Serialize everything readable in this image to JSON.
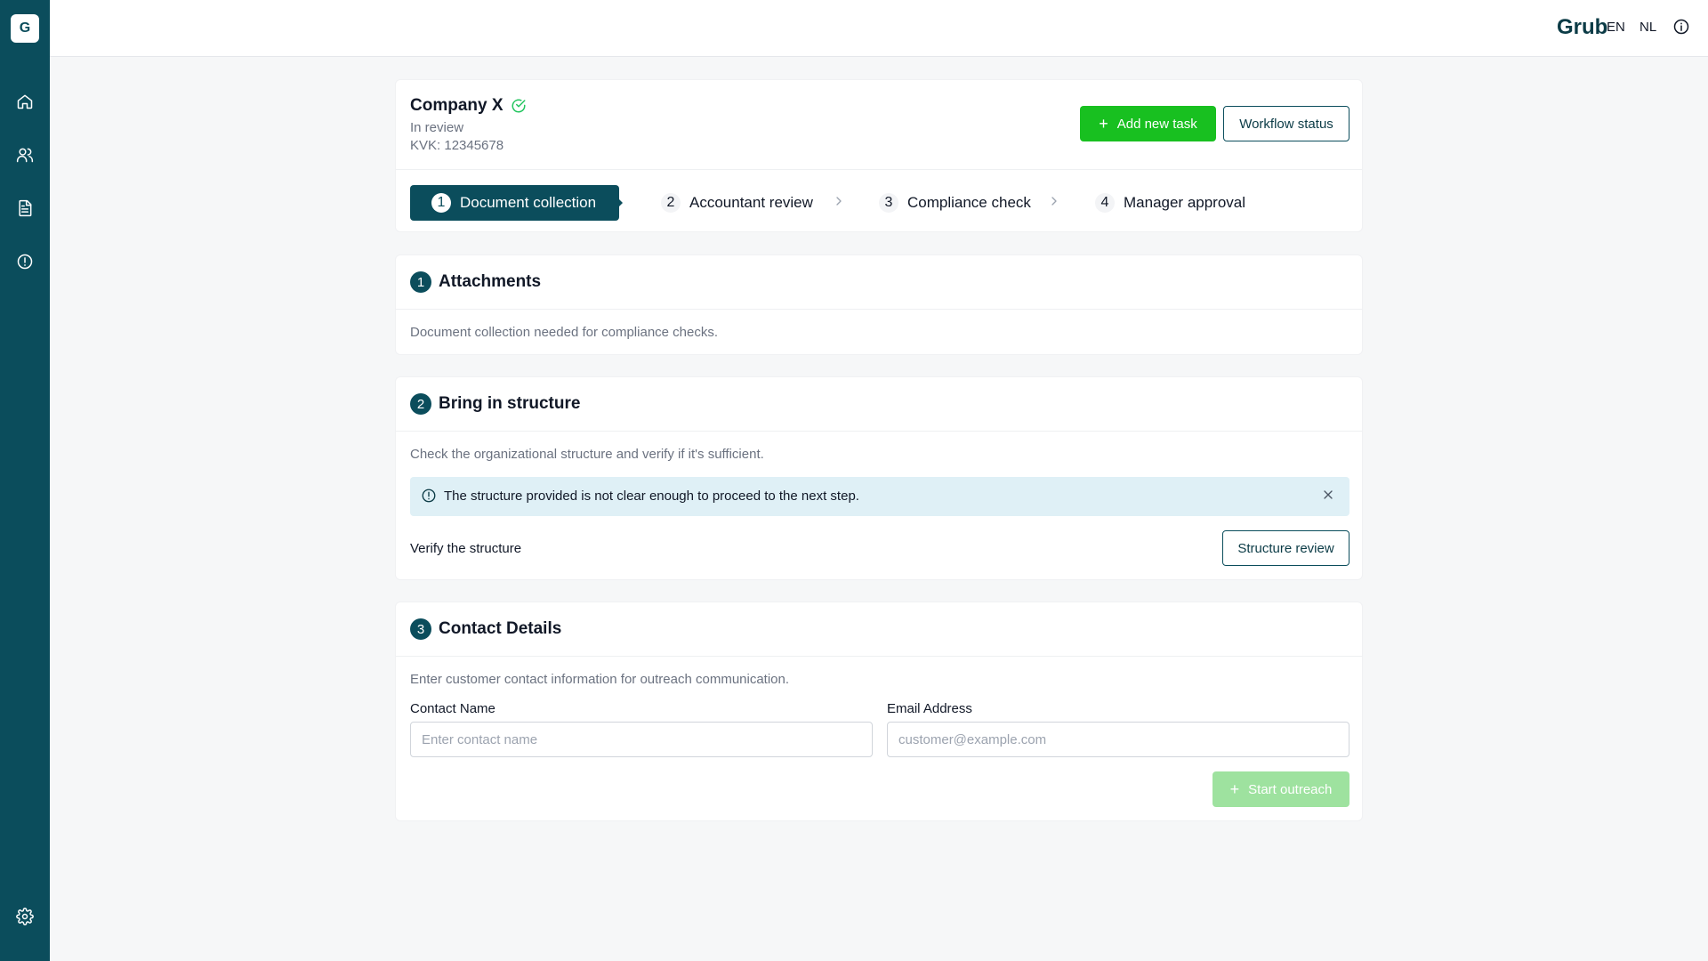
{
  "sidebar": {
    "logo_letter": "G",
    "items": [
      {
        "icon": "home-icon"
      },
      {
        "icon": "users-icon"
      },
      {
        "icon": "document-icon"
      },
      {
        "icon": "alert-circle-icon"
      },
      {
        "icon": "gear-icon"
      }
    ]
  },
  "header": {
    "brand": "Grub",
    "languages": [
      "EN",
      "NL"
    ],
    "info_icon": "info-icon"
  },
  "company": {
    "name": "Company X",
    "verified_icon": "check-circle-icon",
    "status": "In review",
    "kvk": "KVK: 12345678",
    "add_task_label": "Add new task",
    "workflow_status_label": "Workflow status"
  },
  "stepper": {
    "steps": [
      {
        "number": "1",
        "label": "Document collection",
        "active": true
      },
      {
        "number": "2",
        "label": "Accountant review",
        "active": false
      },
      {
        "number": "3",
        "label": "Compliance check",
        "active": false
      },
      {
        "number": "4",
        "label": "Manager approval",
        "active": false
      }
    ]
  },
  "sections": {
    "attachments": {
      "number": "1",
      "title": "Attachments",
      "description": "Document collection needed for compliance checks."
    },
    "structure": {
      "number": "2",
      "title": "Bring in structure",
      "description": "Check the organizational structure and verify if it's sufficient.",
      "alert_text": "The structure provided is not clear enough to proceed to the next step.",
      "verify_label": "Verify the structure",
      "review_button": "Structure review"
    },
    "contact": {
      "number": "3",
      "title": "Contact Details",
      "description": "Enter customer contact information for outreach communication.",
      "name_label": "Contact Name",
      "name_placeholder": "Enter contact name",
      "email_label": "Email Address",
      "email_placeholder": "customer@example.com",
      "outreach_button": "Start outreach"
    }
  },
  "colors": {
    "sidebar": "#0b4d5c",
    "primary_green": "#18c020",
    "alert_bg": "#dff0f6"
  }
}
